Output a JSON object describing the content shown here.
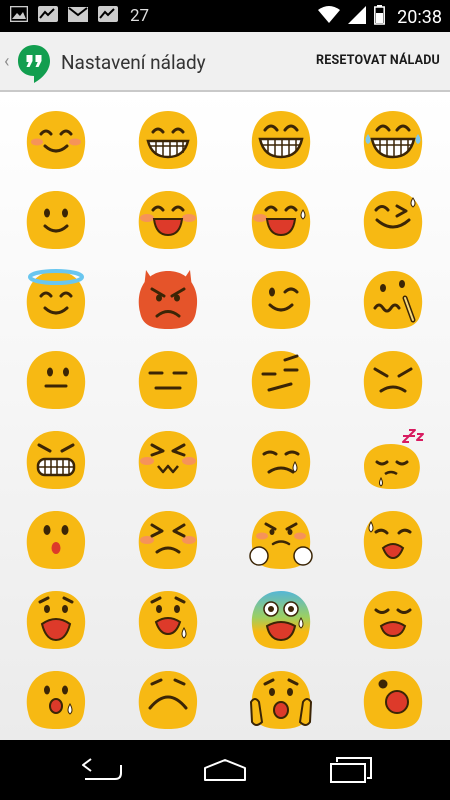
{
  "status_bar": {
    "notification_icons": [
      "image-icon",
      "trend-icon",
      "gmail-icon",
      "trend-icon"
    ],
    "notification_count": "27",
    "system_icons": [
      "wifi-icon",
      "signal-icon",
      "battery-icon"
    ],
    "clock": "20:38"
  },
  "action_bar": {
    "up_icon": "chevron-left-icon",
    "app_icon": "hangouts-icon",
    "title": "Nastavení nálady",
    "reset_label": "RESETOVAT NÁLADU"
  },
  "mood_grid": {
    "columns": 4,
    "moods": [
      "smiling-blush-emoji",
      "grinning-emoji",
      "grinning-happy-eyes-emoji",
      "laughing-tears-emoji",
      "smile-emoji",
      "laughing-blush-emoji",
      "laughing-sweat-emoji",
      "laughing-squint-emoji",
      "halo-smile-emoji",
      "devil-emoji",
      "winking-emoji",
      "confused-squiggle-emoji",
      "neutral-side-emoji",
      "expressionless-emoji",
      "skeptical-emoji",
      "angry-emoji",
      "grimacing-angry-emoji",
      "fuming-emoji",
      "disappointed-tear-emoji",
      "sleeping-emoji",
      "surprised-emoji",
      "squint-frown-emoji",
      "angry-fists-emoji",
      "worried-sweat-emoji",
      "anguished-emoji",
      "anxious-sweat-emoji",
      "screaming-fear-emoji",
      "tired-emoji",
      "open-mouth-sweat-emoji",
      "frowning-emoji",
      "scared-hands-emoji",
      "shocked-emoji"
    ]
  },
  "nav_bar": {
    "back_icon": "back-icon",
    "home_icon": "home-icon",
    "recents_icon": "recents-icon"
  },
  "colors": {
    "emoji_yellow": "#f7b913",
    "devil_orange": "#e5542a",
    "blush": "#f58a6b",
    "mouth_red": "#dd3a2a",
    "action_bar_bg": "#f0f0f0",
    "hangouts_green": "#129e4f"
  }
}
